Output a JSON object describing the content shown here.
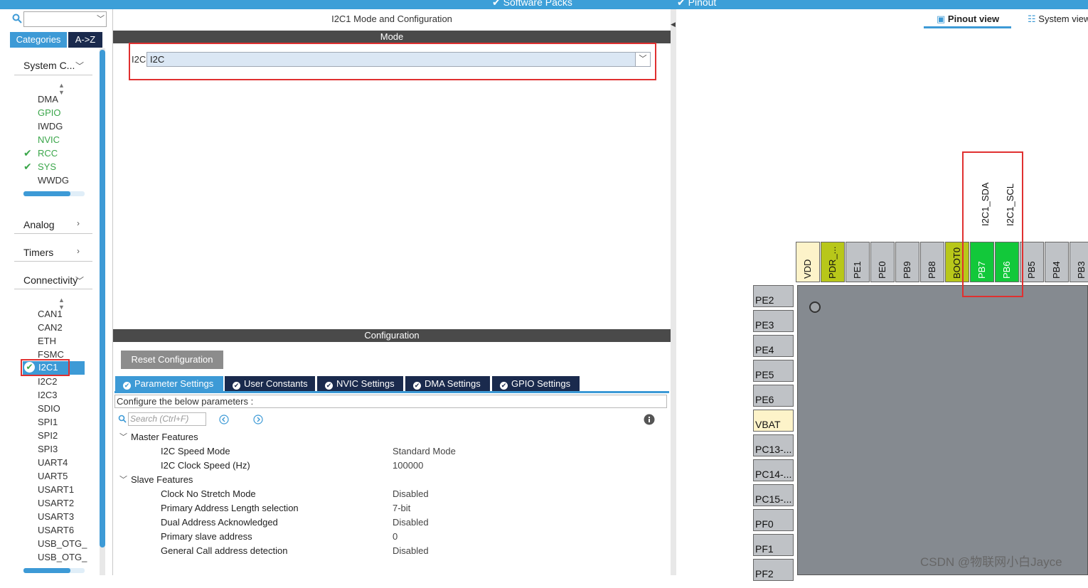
{
  "topbar": {
    "software_packs": "Software Packs",
    "pinout": "Pinout"
  },
  "left": {
    "tabs": {
      "categories": "Categories",
      "az": "A->Z"
    },
    "categories": [
      {
        "label": "System C...",
        "expanded": true,
        "items": [
          {
            "label": "DMA",
            "state": "normal"
          },
          {
            "label": "GPIO",
            "state": "green"
          },
          {
            "label": "IWDG",
            "state": "normal"
          },
          {
            "label": "NVIC",
            "state": "green"
          },
          {
            "label": "RCC",
            "state": "checked"
          },
          {
            "label": "SYS",
            "state": "checked"
          },
          {
            "label": "WWDG",
            "state": "normal"
          }
        ]
      },
      {
        "label": "Analog",
        "expanded": false
      },
      {
        "label": "Timers",
        "expanded": false
      },
      {
        "label": "Connectivity",
        "expanded": true,
        "items": [
          {
            "label": "CAN1"
          },
          {
            "label": "CAN2"
          },
          {
            "label": "ETH"
          },
          {
            "label": "FSMC"
          },
          {
            "label": "I2C1",
            "selected": true
          },
          {
            "label": "I2C2"
          },
          {
            "label": "I2C3"
          },
          {
            "label": "SDIO"
          },
          {
            "label": "SPI1"
          },
          {
            "label": "SPI2"
          },
          {
            "label": "SPI3"
          },
          {
            "label": "UART4"
          },
          {
            "label": "UART5"
          },
          {
            "label": "USART1"
          },
          {
            "label": "USART2"
          },
          {
            "label": "USART3"
          },
          {
            "label": "USART6"
          },
          {
            "label": "USB_OTG_"
          },
          {
            "label": "USB_OTG_"
          }
        ]
      }
    ]
  },
  "mid": {
    "title": "I2C1 Mode and Configuration",
    "mode_header": "Mode",
    "i2c_label": "I2C",
    "i2c_value": "I2C",
    "config_header": "Configuration",
    "reset_button": "Reset Configuration",
    "tabs": [
      "Parameter Settings",
      "User Constants",
      "NVIC Settings",
      "DMA Settings",
      "GPIO Settings"
    ],
    "hint": "Configure the below parameters :",
    "search_placeholder": "Search (Ctrl+F)",
    "groups": [
      {
        "name": "Master Features",
        "params": [
          {
            "name": "I2C Speed Mode",
            "value": "Standard Mode"
          },
          {
            "name": "I2C Clock Speed (Hz)",
            "value": "100000"
          }
        ]
      },
      {
        "name": "Slave Features",
        "params": [
          {
            "name": "Clock No Stretch Mode",
            "value": "Disabled"
          },
          {
            "name": "Primary Address Length selection",
            "value": "7-bit"
          },
          {
            "name": "Dual Address Acknowledged",
            "value": "Disabled"
          },
          {
            "name": "Primary slave address",
            "value": "0"
          },
          {
            "name": "General Call address detection",
            "value": "Disabled"
          }
        ]
      }
    ]
  },
  "right": {
    "pinout_view": "Pinout view",
    "system_view": "System view",
    "top_pins": [
      {
        "label": "VDD",
        "color": "#fdf3c9"
      },
      {
        "label": "PDR_...",
        "color": "#b8c71a"
      },
      {
        "label": "PE1",
        "color": "#bfc2c6"
      },
      {
        "label": "PE0",
        "color": "#bfc2c6"
      },
      {
        "label": "PB9",
        "color": "#bfc2c6"
      },
      {
        "label": "PB8",
        "color": "#bfc2c6"
      },
      {
        "label": "BOOT0",
        "color": "#b8c71a"
      },
      {
        "label": "PB7",
        "color": "#12c83a"
      },
      {
        "label": "PB6",
        "color": "#12c83a"
      },
      {
        "label": "PB5",
        "color": "#bfc2c6"
      },
      {
        "label": "PB4",
        "color": "#bfc2c6"
      },
      {
        "label": "PB3",
        "color": "#bfc2c6"
      }
    ],
    "left_pins": [
      {
        "label": "PE2",
        "color": "#bfc2c6"
      },
      {
        "label": "PE3",
        "color": "#bfc2c6"
      },
      {
        "label": "PE4",
        "color": "#bfc2c6"
      },
      {
        "label": "PE5",
        "color": "#bfc2c6"
      },
      {
        "label": "PE6",
        "color": "#bfc2c6"
      },
      {
        "label": "VBAT",
        "color": "#fdf3c9"
      },
      {
        "label": "PC13-...",
        "color": "#bfc2c6"
      },
      {
        "label": "PC14-...",
        "color": "#bfc2c6"
      },
      {
        "label": "PC15-...",
        "color": "#bfc2c6"
      },
      {
        "label": "PF0",
        "color": "#bfc2c6"
      },
      {
        "label": "PF1",
        "color": "#bfc2c6"
      },
      {
        "label": "PF2",
        "color": "#bfc2c6"
      }
    ],
    "signal_labels": [
      "I2C1_SDA",
      "I2C1_SCL"
    ]
  },
  "watermark": "CSDN @物联网小白Jayce",
  "colors": {
    "accent": "#3d9ad6",
    "navy": "#1a2a4d",
    "highlight_red": "#e03030",
    "pin_green": "#12c83a"
  }
}
